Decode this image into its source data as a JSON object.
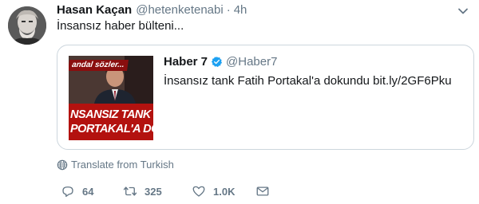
{
  "tweet": {
    "author_name": "Hasan Kaçan",
    "author_handle": "@hetenketenabi",
    "separator": "·",
    "time": "4h",
    "text": "İnsansız haber bülteni...",
    "avatar_icon": "user-avatar-photo",
    "caret_icon": "chevron-down-icon"
  },
  "quote": {
    "author_name": "Haber 7",
    "author_handle": "@Haber7",
    "verified_icon": "verified-badge-icon",
    "text": "İnsansız tank Fatih Portakal'a dokundu bit.ly/2GF6Pku",
    "media": {
      "top_caption": "andal sözler...",
      "line1": "NSANSIZ TANK P",
      "line2": "PORTAKAL'A DOK"
    }
  },
  "translate": {
    "label": "Translate from Turkish",
    "icon": "globe-icon"
  },
  "actions": {
    "reply_count": "64",
    "retweet_count": "325",
    "like_count": "1.0K",
    "reply_icon": "reply-icon",
    "retweet_icon": "retweet-icon",
    "like_icon": "heart-icon",
    "dm_icon": "envelope-icon"
  },
  "colors": {
    "text": "#14171a",
    "secondary": "#657786",
    "border": "#ccd6dd",
    "verified": "#1da1f2",
    "media_red": "#b3120f"
  }
}
